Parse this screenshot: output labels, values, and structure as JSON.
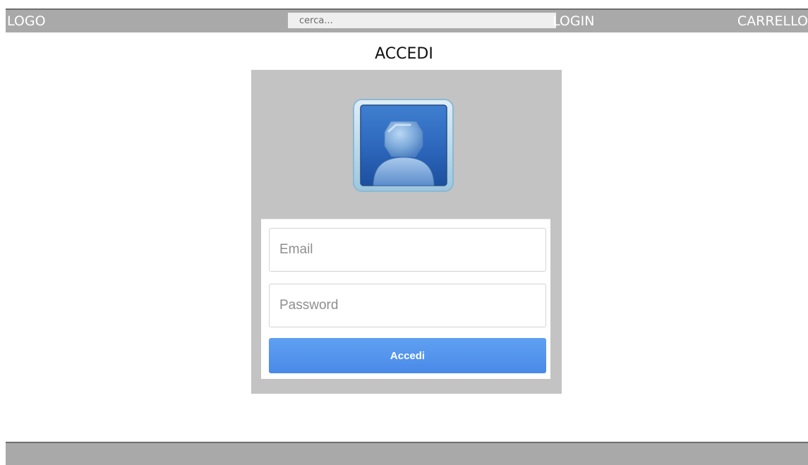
{
  "header": {
    "logo_text": "LOGO",
    "search_placeholder": "cerca...",
    "login_label": "LOGIN",
    "cart_label": "CARRELLO"
  },
  "main": {
    "title": "ACCEDI",
    "form": {
      "email_placeholder": "Email",
      "password_placeholder": "Password",
      "submit_label": "Accedi"
    }
  },
  "colors": {
    "bar_gray": "#a9a9a9",
    "panel_gray": "#c3c3c3",
    "button_blue": "#4a8ae8"
  },
  "icons": {
    "avatar": "user-avatar-icon"
  }
}
